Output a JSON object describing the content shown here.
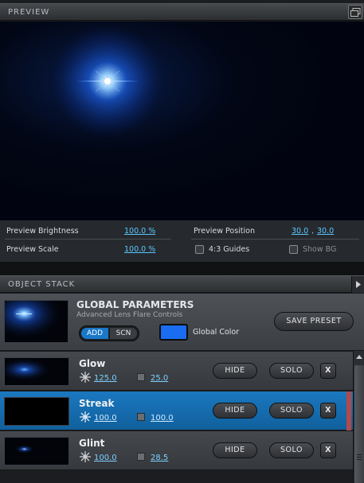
{
  "preview": {
    "title": "PREVIEW",
    "brightness_label": "Preview Brightness",
    "brightness_value": "100.0 %",
    "scale_label": "Preview Scale",
    "scale_value": "100.0 %",
    "position_label": "Preview Position",
    "position_x": "30.0",
    "position_sep": ",",
    "position_y": "30.0",
    "guides_label": "4:3 Guides",
    "showbg_label": "Show BG"
  },
  "stack": {
    "title": "OBJECT STACK"
  },
  "global": {
    "title": "GLOBAL PARAMETERS",
    "subtitle": "Advanced Lens Flare Controls",
    "add_label": "ADD",
    "scn_label": "SCN",
    "color_label": "Global Color",
    "color": "#1a6cf0",
    "save_label": "SAVE PRESET"
  },
  "objects": [
    {
      "name": "Glow",
      "value1": "125.0",
      "value2": "25.0",
      "selected": false
    },
    {
      "name": "Streak",
      "value1": "100.0",
      "value2": "100.0",
      "selected": true
    },
    {
      "name": "Glint",
      "value1": "100.0",
      "value2": "28.5",
      "selected": false
    }
  ],
  "row_buttons": {
    "hide": "HIDE",
    "solo": "SOLO",
    "x": "X"
  },
  "colors": {
    "accent": "#1b78c0",
    "value_link": "#5cc7ff",
    "selected_marker": "#b04a4a"
  }
}
